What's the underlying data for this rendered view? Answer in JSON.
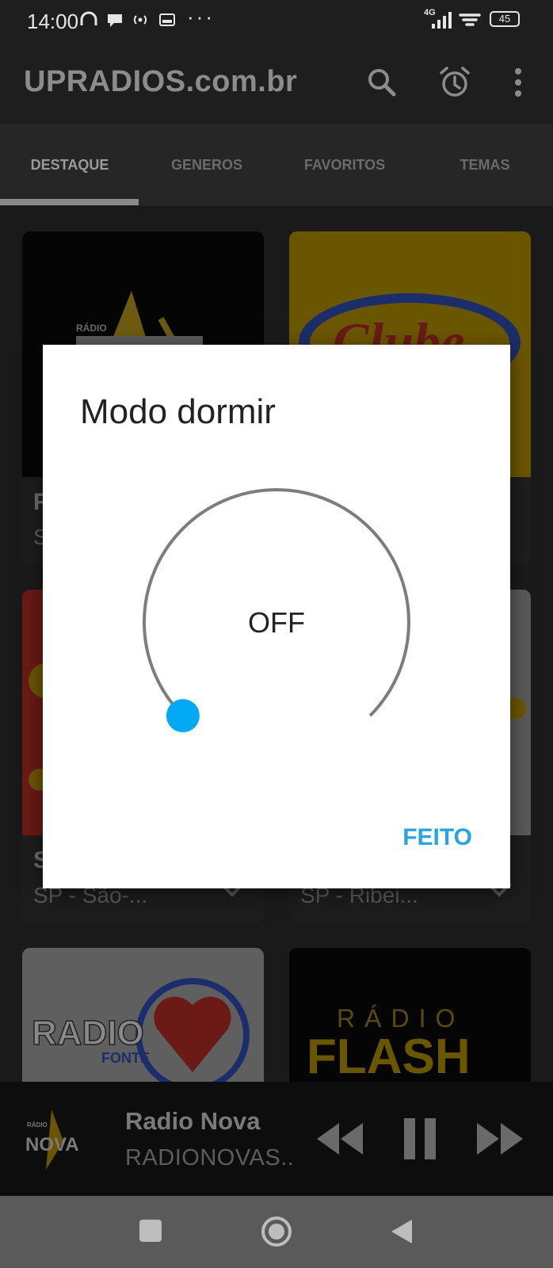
{
  "status_bar": {
    "time": "14:00",
    "network": "4G",
    "battery": "45",
    "icons": [
      "headphones-icon",
      "chat-icon",
      "hotspot-icon",
      "screen-icon",
      "more-dots-icon",
      "signal-icon",
      "wifi-icon",
      "battery-icon"
    ]
  },
  "app_bar": {
    "title": "UPRADIOS.com.br",
    "actions": [
      "search-icon",
      "alarm-clock-icon",
      "overflow-menu-icon"
    ]
  },
  "tabs": {
    "items": [
      "DESTAQUE",
      "GENEROS",
      "FAVORITOS",
      "TEMAS"
    ],
    "active_index": 0
  },
  "cards": [
    {
      "name": "R",
      "location": "S",
      "logo_text": "RÁDIO NOVA"
    },
    {
      "name": "",
      "location": "",
      "logo_text": "Clube"
    },
    {
      "name": "S",
      "location": "SP - São-...",
      "logo_text": ""
    },
    {
      "name": "",
      "location": "SP - Ribei...",
      "logo_text": ""
    },
    {
      "name": "",
      "location": "",
      "logo_text": "RADIO FONTE"
    },
    {
      "name": "",
      "location": "",
      "logo_text": "RÁDIO FLASH"
    }
  ],
  "player": {
    "station": "Radio Nova",
    "subtitle": "RADIONOVAS..",
    "logo_text": "RÁDIO NOVA",
    "state": "playing"
  },
  "dialog": {
    "title": "Modo dormir",
    "value_label": "OFF",
    "done_label": "FEITO",
    "dial_level": 0,
    "accent": "#03a9f4"
  },
  "colors": {
    "accent_blue": "#26a5df",
    "knob_blue": "#03a9f4",
    "card_yellow": "#6b5600",
    "card_red": "#6b1a16"
  }
}
